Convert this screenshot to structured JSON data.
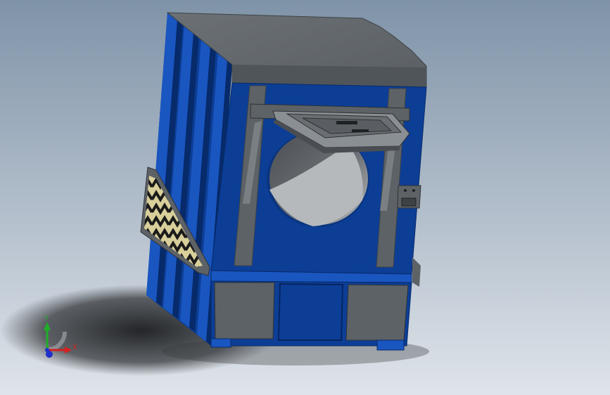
{
  "viewport": {
    "background_top": "#7f93a8",
    "background_bottom": "#dfe4ea"
  },
  "model": {
    "body_blue": "#0c3e96",
    "body_blue_dark": "#072a6a",
    "body_blue_light": "#1a56c0",
    "steel_gray": "#5d6266",
    "steel_dark": "#3e4245",
    "steel_light": "#8a8f93",
    "drum_gray": "#6a6e72",
    "warning_label_color": "#d8cf9a"
  },
  "triad": {
    "x_label": "X",
    "y_label": "Y",
    "x_color": "#d42020",
    "y_color": "#1fae2a",
    "z_color": "#2030c8"
  }
}
